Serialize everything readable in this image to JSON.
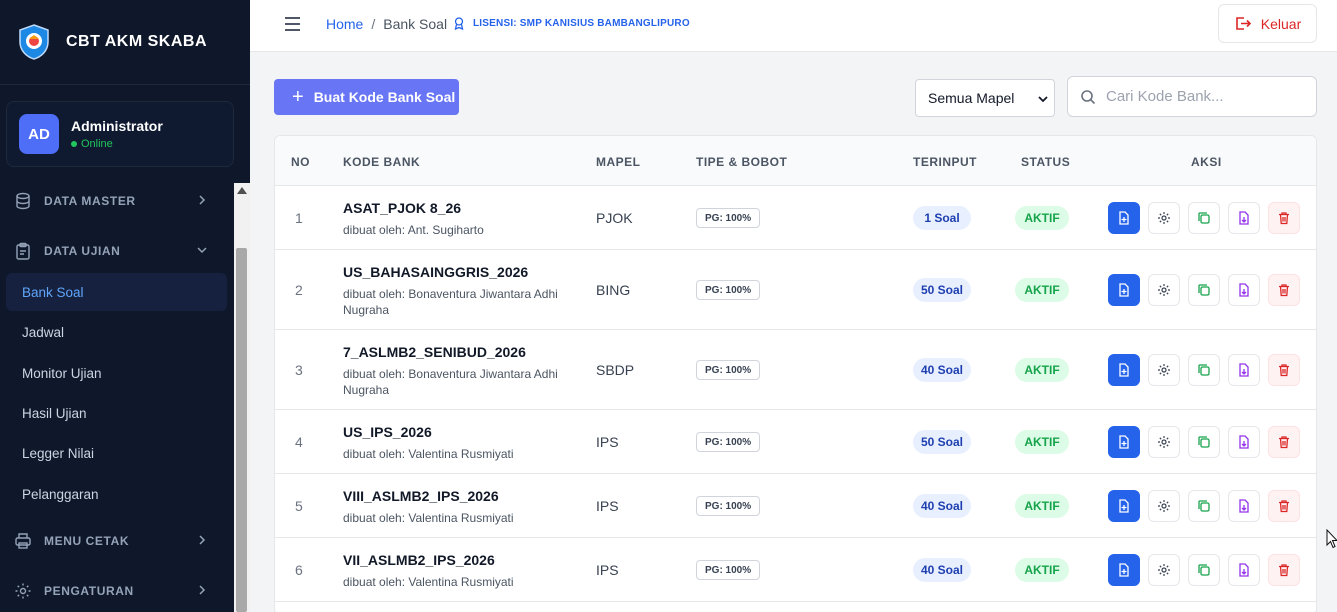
{
  "app": {
    "title": "CBT AKM SKABA"
  },
  "user": {
    "initials": "AD",
    "name": "Administrator",
    "status": "Online"
  },
  "sidebar": {
    "sections": [
      {
        "label": "DATA MASTER"
      },
      {
        "label": "DATA UJIAN"
      },
      {
        "label": "MENU CETAK"
      },
      {
        "label": "PENGATURAN"
      }
    ],
    "items": [
      {
        "label": "Bank Soal"
      },
      {
        "label": "Jadwal"
      },
      {
        "label": "Monitor Ujian"
      },
      {
        "label": "Hasil Ujian"
      },
      {
        "label": "Legger Nilai"
      },
      {
        "label": "Pelanggaran"
      }
    ]
  },
  "header": {
    "breadcrumb_home": "Home",
    "breadcrumb_sep": "/",
    "breadcrumb_current": "Bank Soal",
    "license": "LISENSI: SMP KANISIUS BAMBANGLIPURO",
    "logout_label": "Keluar"
  },
  "toolbar": {
    "create_label": "Buat Kode Bank Soal",
    "filter_value": "Semua Mapel",
    "search_placeholder": "Cari Kode Bank..."
  },
  "table": {
    "columns": [
      "NO",
      "KODE BANK",
      "MAPEL",
      "TIPE & BOBOT",
      "TERINPUT",
      "STATUS",
      "AKSI"
    ],
    "rows": [
      {
        "no": "1",
        "kode": "ASAT_PJOK 8_26",
        "by": "dibuat oleh: Ant. Sugiharto",
        "mapel": "PJOK",
        "tipe": "PG: 100%",
        "soal": "1 Soal",
        "status": "AKTIF"
      },
      {
        "no": "2",
        "kode": "US_BAHASAINGGRIS_2026",
        "by": "dibuat oleh: Bonaventura Jiwantara Adhi Nugraha",
        "mapel": "BING",
        "tipe": "PG: 100%",
        "soal": "50 Soal",
        "status": "AKTIF"
      },
      {
        "no": "3",
        "kode": "7_ASLMB2_SENIBUD_2026",
        "by": "dibuat oleh: Bonaventura Jiwantara Adhi Nugraha",
        "mapel": "SBDP",
        "tipe": "PG: 100%",
        "soal": "40 Soal",
        "status": "AKTIF"
      },
      {
        "no": "4",
        "kode": "US_IPS_2026",
        "by": "dibuat oleh: Valentina Rusmiyati",
        "mapel": "IPS",
        "tipe": "PG: 100%",
        "soal": "50 Soal",
        "status": "AKTIF"
      },
      {
        "no": "5",
        "kode": "VIII_ASLMB2_IPS_2026",
        "by": "dibuat oleh: Valentina Rusmiyati",
        "mapel": "IPS",
        "tipe": "PG: 100%",
        "soal": "40 Soal",
        "status": "AKTIF"
      },
      {
        "no": "6",
        "kode": "VII_ASLMB2_IPS_2026",
        "by": "dibuat oleh: Valentina Rusmiyati",
        "mapel": "IPS",
        "tipe": "PG: 100%",
        "soal": "40 Soal",
        "status": "AKTIF"
      }
    ]
  },
  "icons": {
    "actions": [
      "file-plus-icon",
      "gear-icon",
      "copy-icon",
      "file-download-icon",
      "trash-icon"
    ]
  },
  "colors": {
    "sidebar_bg": "#0f172a",
    "accent": "#6875f5",
    "primary": "#2563eb",
    "danger": "#dc2626",
    "success": "#16a34a"
  }
}
